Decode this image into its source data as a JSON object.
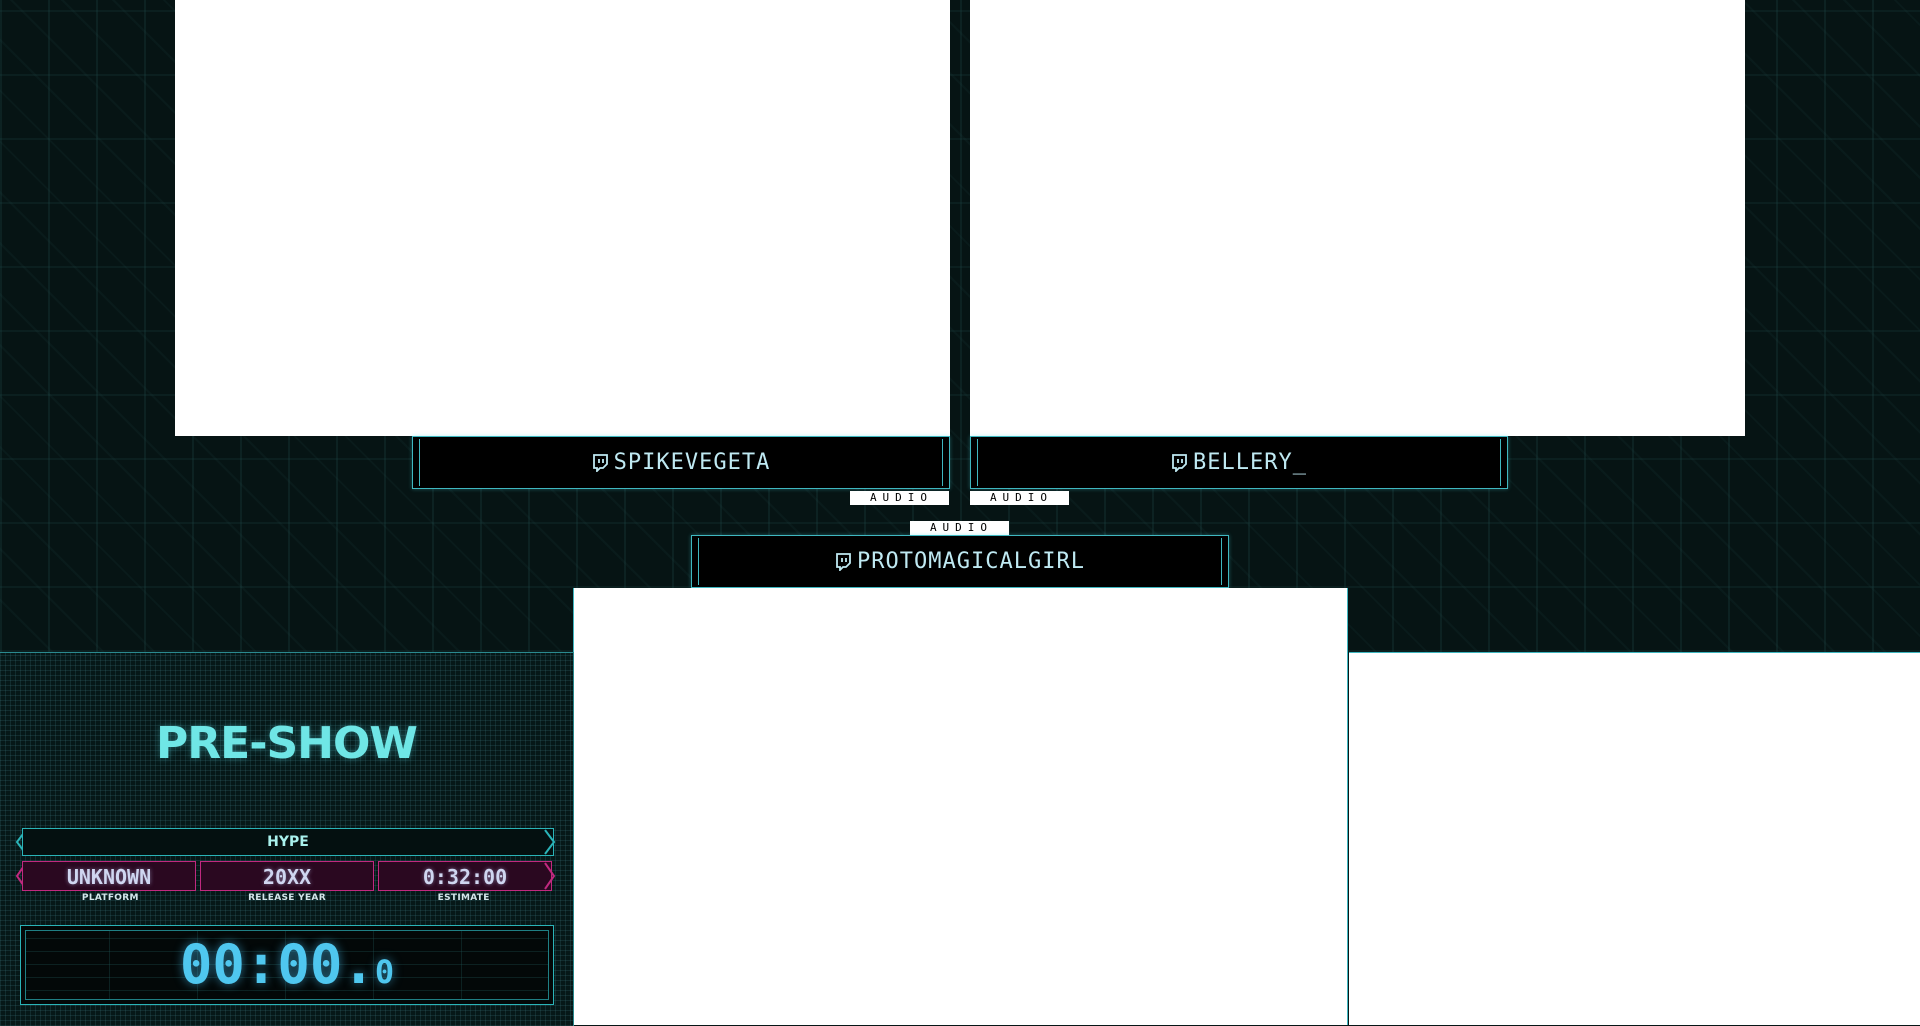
{
  "cameras": [
    {
      "runner": "SPIKEVEGETA",
      "audio_label": "AUDIO"
    },
    {
      "runner": "BELLERY_",
      "audio_label": "AUDIO"
    },
    {
      "runner": "PROTOMAGICALGIRL",
      "audio_label": "AUDIO"
    }
  ],
  "icons": {
    "runner_icon": "twitch-icon"
  },
  "info": {
    "title": "PRE-SHOW",
    "hype_label": "HYPE",
    "platform": "UNKNOWN",
    "platform_label": "PLATFORM",
    "release_year": "20XX",
    "release_year_label": "RELEASE YEAR",
    "estimate": "0:32:00",
    "estimate_label": "ESTIMATE"
  },
  "timer": {
    "main": "00:00.",
    "tenths": "0"
  },
  "colors": {
    "accent": "#3fb7c0",
    "title": "#6fe6e6",
    "magenta": "#c0297f",
    "timer": "#4fc7ef"
  }
}
